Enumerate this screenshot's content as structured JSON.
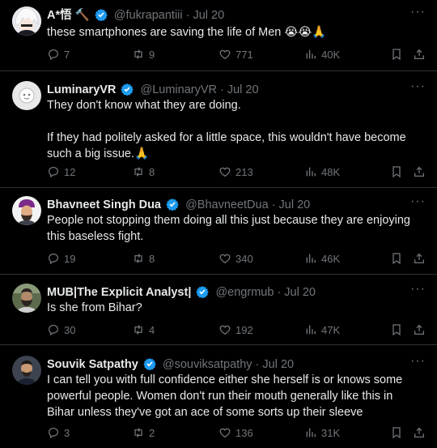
{
  "tweets": [
    {
      "name": "A*悟 🔨",
      "handle": "@fukrapantiii",
      "date": "· Jul 20",
      "text": "these smartphones are saving the life of Men 😭😭🙏",
      "replies": "7",
      "retweets": "9",
      "likes": "771",
      "views": "40K"
    },
    {
      "name": "LuminaryVR",
      "handle": "@LuminaryVR",
      "date": "· Jul 20",
      "text": "They don't know what they are doing.\n\nIf they had politely asked for a little space, this wouldn't have become such a big issue.🙏",
      "replies": "12",
      "retweets": "8",
      "likes": "213",
      "views": "48K"
    },
    {
      "name": "Bhavneet Singh Dua",
      "handle": "@BhavneetDua",
      "date": "· Jul 20",
      "text": "People not stopping them doing all this just because they are enjoying this baseless fight.",
      "replies": "19",
      "retweets": "8",
      "likes": "340",
      "views": "46K"
    },
    {
      "name": "MUB|The Explicit Analyst|",
      "handle": "@engrmub",
      "date": "· Jul 20",
      "text": "Is she from Bihar?",
      "replies": "30",
      "retweets": "4",
      "likes": "192",
      "views": "47K"
    },
    {
      "name": "Souvik Satpathy",
      "handle": "@souviksatpathy",
      "date": "· Jul 20",
      "text": "I can tell you with full confidence either she herself is or knows some powerful people. Women don't run their mouth generally like this in Bihar unless they've got an ace of some sorts up their sleeve",
      "replies": "3",
      "retweets": "2",
      "likes": "136",
      "views": "31K"
    }
  ],
  "colors": {
    "verified": "#1d9bf0",
    "muted": "#71767b",
    "text": "#e7e9ea",
    "divider": "#2f3336"
  }
}
